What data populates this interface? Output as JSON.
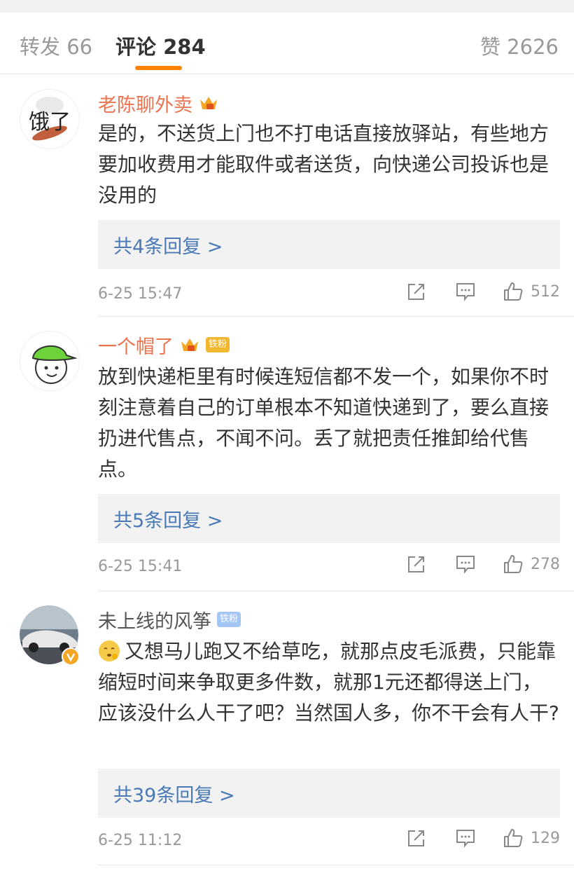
{
  "tabs": {
    "repost": "转发 66",
    "comments": "评论 284",
    "likes": "赞 2626"
  },
  "comments": [
    {
      "user": "老陈聊外卖",
      "avatar_text": "饿了",
      "content": "是的，不送货上门也不打电话直接放驿站，有些地方要加收费用才能取件或者送货，向快递公司投诉也是没用的",
      "replies": "共4条回复 >",
      "time": "6-25 15:47",
      "likes": "512"
    },
    {
      "user": "一个帽了",
      "badge": "铁粉",
      "content": "放到快递柜里有时候连短信都不发一个，如果你不时刻注意着自己的订单根本不知道快递到了，要么直接扔进代售点，不闻不问。丢了就把责任推卸给代售点。",
      "replies": "共5条回复 >",
      "time": "6-25 15:41",
      "likes": "278"
    },
    {
      "user": "未上线的风筝",
      "badge": "铁粉",
      "content": "又想马儿跑又不给草吃，就那点皮毛派费，只能靠缩短时间来争取更多件数，就那1元还都得送上门，应该没什么人干了吧？当然国人多，你不干会有人干?",
      "replies": "共39条回复 >",
      "time": "6-25 11:12",
      "likes": "129"
    }
  ],
  "colors": {
    "accent": "#ff8200",
    "username": "#eb7350",
    "link": "#4a7ab5",
    "meta": "#999999"
  },
  "icons": [
    "vip-crown-icon",
    "share-icon",
    "comment-icon",
    "like-icon",
    "verified-icon",
    "emoji-icon"
  ]
}
